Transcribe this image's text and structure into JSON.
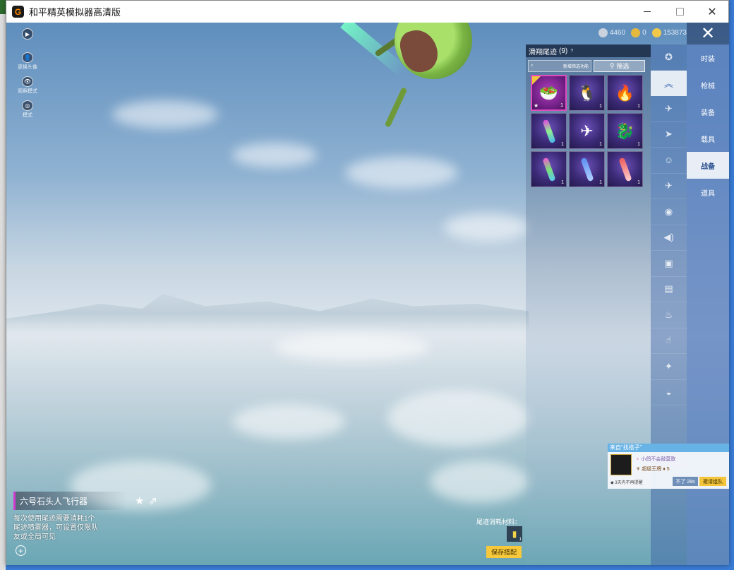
{
  "window": {
    "title": "和平精英模拟器高清版",
    "logo_glyph": "G"
  },
  "window_controls": {
    "minimize": "",
    "maximize": "",
    "close": "✕"
  },
  "left_tools": [
    {
      "icon": "▶",
      "label": ""
    },
    {
      "icon": "👤",
      "label": "更换头像"
    },
    {
      "icon": "👁",
      "label": "观察模式"
    },
    {
      "icon": "◎",
      "label": "模式"
    }
  ],
  "currency": [
    {
      "value": "4460",
      "color": "#c9d2dd"
    },
    {
      "value": "0",
      "color": "#e5b93e"
    },
    {
      "value": "153873",
      "color": "#f0c94a"
    }
  ],
  "close_glyph": "✕",
  "categories": [
    {
      "label": "时装"
    },
    {
      "label": "枪械"
    },
    {
      "label": "装备"
    },
    {
      "label": "载具"
    },
    {
      "label": "战备",
      "active": true
    },
    {
      "label": "道具"
    }
  ],
  "icon_rail": [
    {
      "icon": "✪"
    },
    {
      "icon": "︽",
      "active": true
    },
    {
      "icon": "✈"
    },
    {
      "icon": "➤"
    },
    {
      "icon": "☺"
    },
    {
      "icon": "✈"
    },
    {
      "icon": "◉"
    },
    {
      "icon": "◀)"
    },
    {
      "icon": "▣"
    },
    {
      "icon": "▤"
    },
    {
      "icon": "♨"
    },
    {
      "icon": "☝"
    },
    {
      "icon": "✦"
    },
    {
      "icon": "◒"
    }
  ],
  "panel": {
    "title": "滑翔尾迹",
    "count": "(9)",
    "search_placeholder": "新增筛选功能",
    "filter_label": "筛选"
  },
  "items": [
    {
      "glyph": "🥗",
      "count": "1",
      "selected": true
    },
    {
      "glyph": "🐧",
      "count": "1"
    },
    {
      "glyph": "🔥",
      "count": "1"
    },
    {
      "glyph": "",
      "count": "1",
      "trail": "#e04be0"
    },
    {
      "glyph": "✈",
      "count": "1"
    },
    {
      "glyph": "🐉",
      "count": "1"
    },
    {
      "glyph": "",
      "count": "1",
      "trail": "#7ae07a"
    },
    {
      "glyph": "",
      "count": "1",
      "trail": "#5b8ff0"
    },
    {
      "glyph": "",
      "count": "1",
      "trail": "#f05b5b"
    }
  ],
  "detail": {
    "name": "六号石头人飞行器",
    "description": "每次使用尾迹需要消耗1个尾迹喷雾器，可设置仅限队友或全局可见"
  },
  "materials": {
    "label": "尾迹消耗材料：",
    "count": "1"
  },
  "save_button": "保存搭配",
  "invite": {
    "header": "来自“找搭子”",
    "name": "小鸽不会敲莫歌",
    "rank": "超级王牌",
    "rank_level": "5",
    "note": "◆ 3天内不再提醒",
    "decline": "不了 28s",
    "accept": "邀请组队"
  }
}
